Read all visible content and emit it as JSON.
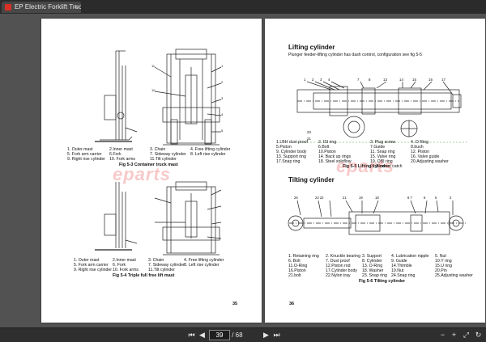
{
  "tab": {
    "title": "EP Electric Forklift Truc...",
    "close": "×"
  },
  "toolbar": {
    "current_page": "39",
    "total_pages": "/ 68",
    "page_sep": "/",
    "icons": [
      "first-page-icon",
      "prev-page-icon",
      "next-page-icon",
      "last-page-icon",
      "zoom-out-icon",
      "zoom-in-icon",
      "rotate-icon",
      "fit-icon"
    ]
  },
  "left_page": {
    "figure1_captions": [
      "1. Outer mast",
      "2.Inner mast",
      "3.     Chain",
      "4. Free lifting cylinder",
      "5. Fork arm carrier",
      "6.Fork",
      "7. Sideway cylinder",
      "8. Left rise cylinder",
      "9. Right rise cylinder",
      "10. Fork arms",
      "11.Tilt cylinder"
    ],
    "figure1_title": "Fig 5-3    Container truck mast",
    "figure2_captions": [
      "1. Outer mast",
      "2.Inner mast",
      "3. Chain",
      "4. Free lifting cylinder",
      "5. Fork arm carrier",
      "6. Fork",
      "7. Sideway cylinder",
      "8. Left rise cylinder",
      "9. Right rise cylinder",
      "10. Fork arms",
      "11.Tilt cylinder"
    ],
    "figure2_title": "Fig 5-4 Triple full free lift mast",
    "page_number": "35",
    "watermark": "eparts"
  },
  "right_page": {
    "lifting_title": "Lifting cylinder",
    "lifting_intro": "Plunger feeder-lifting cylinder has dash control, configuration see fig 5-5",
    "lifting_captions": [
      "1.LBH dust proof",
      "2. ISI ring",
      "3. Plug screw",
      "4. O Ring",
      "5.Piston",
      "6.Bolt",
      "7.Guide",
      "8.bush",
      "9. Cylinder body",
      "10.Piston",
      "11. Snap ring",
      "12. Piston",
      "13. Support ring",
      "14. Back up rings",
      "15. Valve ring",
      "16. Valve guide",
      "17.Snap ring",
      "18. Steel soloflow",
      "19. OBI ring",
      "20.Adjusting washer",
      "21.Blowout catch"
    ],
    "lifting_fig": "Fig 5-5 Lifting cylinder",
    "tilting_title": "Tilting cylinder",
    "tilting_captions": [
      "1. Retaining ring",
      "2. Knuckle bearing",
      "3. Support",
      "4. Lubrication nipple",
      "5. Nut",
      "6. Bolt",
      "7. Dust proof",
      "8. Cylinder",
      "9. Guide",
      "10.Y ring",
      "11.O-Ring",
      "12.Piston rod",
      "13. O-Ring",
      "14.Thimble",
      "15.U ring",
      "16.Piston",
      "17.Cylinder body",
      "18. Washer",
      "19.Nut",
      "20.Pin",
      "21.bolt",
      "22.Nylon tray",
      "23. Snap ring",
      "24.Snap ring",
      "25.Adjusting washer"
    ],
    "tilting_fig": "Fig 5-6    Tilting cylinder",
    "page_number": "36",
    "watermark": "eparts"
  }
}
